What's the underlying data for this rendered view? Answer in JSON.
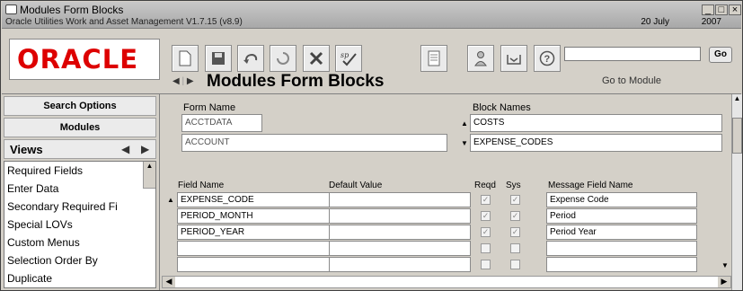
{
  "window": {
    "title": "Modules Form Blocks",
    "subtitle": "Oracle Utilities Work and Asset Management V1.7.15 (v8.9)",
    "date": "20 July",
    "year": "2007",
    "controls": [
      "_",
      "□",
      "×"
    ]
  },
  "header": {
    "logo_text": "ORACLE",
    "page_title": "Modules Form Blocks",
    "goto_label": "Go to Module",
    "goto_value": "",
    "go_button": "Go",
    "toolbar": [
      "new-icon",
      "save-icon",
      "undo-icon",
      "refresh-icon",
      "cancel-icon",
      "spell-icon",
      "report-icon",
      "user-icon",
      "inbox-icon",
      "help-icon"
    ]
  },
  "sidebar": {
    "search_options": "Search Options",
    "modules": "Modules",
    "views_label": "Views",
    "views_items": [
      "Required Fields",
      "Enter Data",
      "Secondary Required Fi",
      "Special LOVs",
      "Custom Menus",
      "Selection Order By",
      "Duplicate"
    ]
  },
  "form": {
    "form_name_label": "Form Name",
    "form_name_1": "ACCTDATA",
    "form_name_2": "ACCOUNT",
    "block_names_label": "Block Names",
    "block_1": "COSTS",
    "block_2": "EXPENSE_CODES"
  },
  "grid": {
    "headers": {
      "field_name": "Field Name",
      "default_value": "Default Value",
      "reqd": "Reqd",
      "sys": "Sys",
      "message_field": "Message Field Name"
    },
    "rows": [
      {
        "field": "EXPENSE_CODE",
        "default": "",
        "reqd": true,
        "sys": true,
        "message": "Expense Code"
      },
      {
        "field": "PERIOD_MONTH",
        "default": "",
        "reqd": true,
        "sys": true,
        "message": "Period"
      },
      {
        "field": "PERIOD_YEAR",
        "default": "",
        "reqd": true,
        "sys": true,
        "message": "Period Year"
      },
      {
        "field": "",
        "default": "",
        "reqd": false,
        "sys": false,
        "message": ""
      },
      {
        "field": "",
        "default": "",
        "reqd": false,
        "sys": false,
        "message": ""
      }
    ]
  }
}
